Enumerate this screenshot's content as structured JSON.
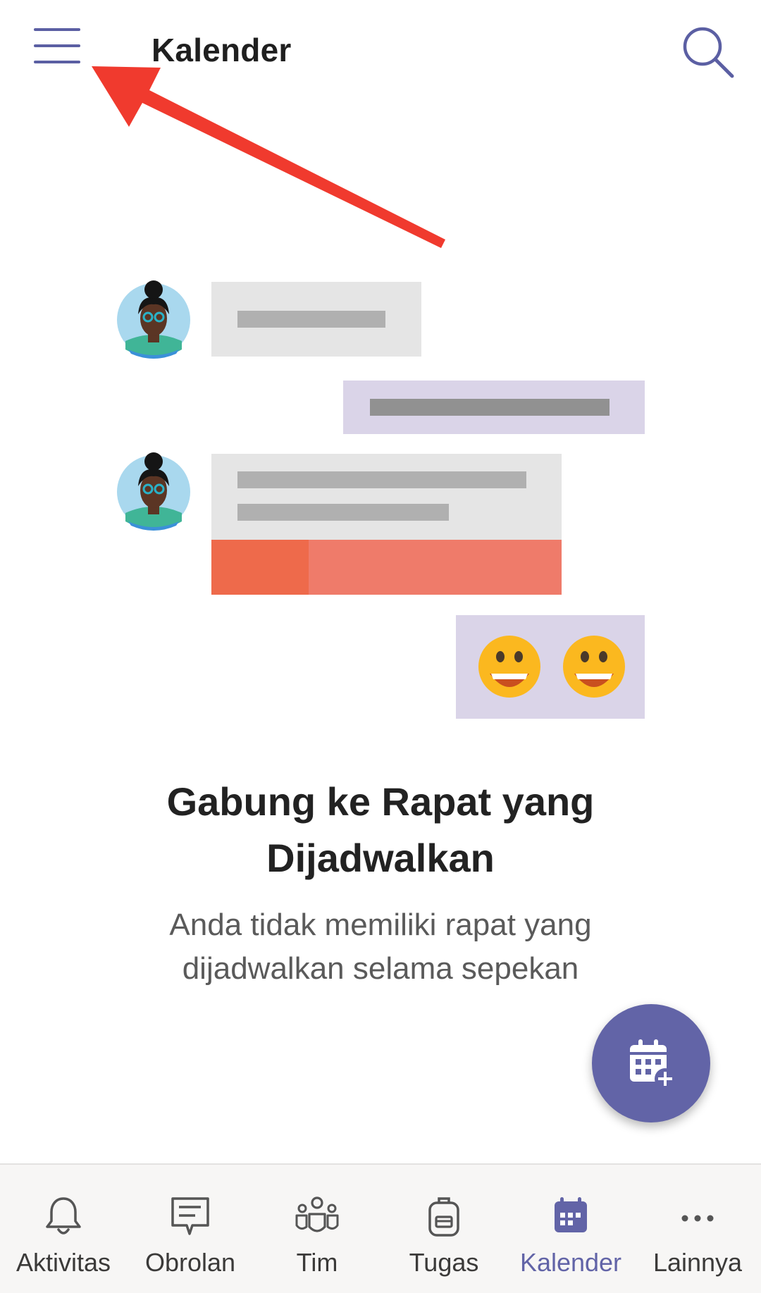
{
  "header": {
    "title": "Kalender",
    "menu_icon": "hamburger-menu-icon",
    "search_icon": "search-icon"
  },
  "annotation": {
    "arrow_color": "#f03a2e"
  },
  "empty_state": {
    "title_line1": "Gabung ke Rapat yang",
    "title_line2": "Dijadwalkan",
    "subtitle_line1": "Anda tidak memiliki rapat yang",
    "subtitle_line2": "dijadwalkan selama sepekan"
  },
  "fab": {
    "icon": "calendar-add-icon"
  },
  "bottom_nav": {
    "items": [
      {
        "label": "Aktivitas",
        "icon": "bell-icon"
      },
      {
        "label": "Obrolan",
        "icon": "chat-icon"
      },
      {
        "label": "Tim",
        "icon": "teams-icon"
      },
      {
        "label": "Tugas",
        "icon": "backpack-icon"
      },
      {
        "label": "Kalender",
        "icon": "calendar-icon",
        "active": true
      },
      {
        "label": "Lainnya",
        "icon": "more-icon"
      }
    ]
  },
  "colors": {
    "accent": "#6264a7",
    "text_primary": "#222222",
    "text_secondary": "#5a5a5a",
    "nav_background": "#f7f6f5"
  }
}
